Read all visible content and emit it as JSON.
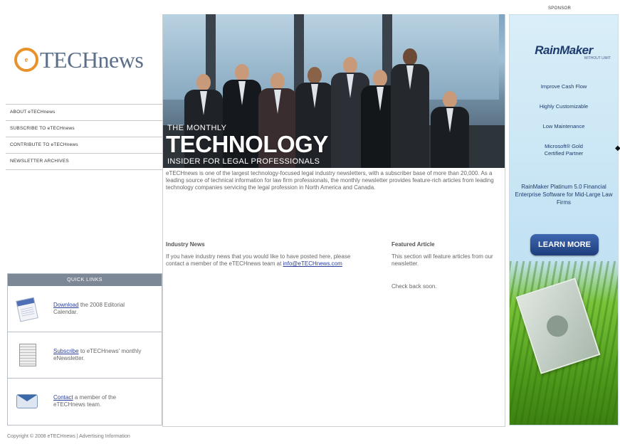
{
  "logo": {
    "mark": "e",
    "text": "TECHnews"
  },
  "nav": [
    {
      "label": "ABOUT eTECHnews"
    },
    {
      "label": "SUBSCRIBE TO eTECHnews"
    },
    {
      "label": "CONTRIBUTE TO eTECHnews"
    },
    {
      "label": "NEWSLETTER ARCHIVES"
    }
  ],
  "hero": {
    "kicker": "THE MONTHLY",
    "title": "TECHNOLOGY",
    "subtitle": "INSIDER FOR LEGAL PROFESSIONALS"
  },
  "intro": "eTECHnews is one of the largest technology-focused legal industry newsletters, with a subscriber base of more than 20,000. As a leading source of technical information for law firm professionals, the monthly newsletter provides feature-rich articles from leading technology companies servicing the legal profession in North America and Canada.",
  "industry_news": {
    "title": "Industry News",
    "text": "If you have industry news that you would like to have posted here, please contact a member of the eTECHnews team at",
    "link": "info@eTECHnews.com"
  },
  "featured": {
    "title": "Featured Article",
    "text": "This section will feature articles from our newsletter.",
    "text2": "Check back soon."
  },
  "quick_links": {
    "title": "QUICK LINKS",
    "items": [
      {
        "link": "Download",
        "text": "the 2008 Editorial Calendar.",
        "icon": "calendar-icon"
      },
      {
        "link": "Subscribe",
        "text": "to eTECHnews' monthly eNewsletter.",
        "icon": "newsletter-icon"
      },
      {
        "link": "Contact",
        "text": "a member of the eTECHnews team.",
        "icon": "mail-icon"
      }
    ]
  },
  "sponsor": {
    "label": "SPONSOR",
    "brand": "RainMaker",
    "brand_sub": "WITHOUT LIMIT",
    "lines": [
      "Improve Cash Flow",
      "Highly Customizable",
      "Low Maintenance",
      "Microsoft® Gold",
      "Certified Partner"
    ],
    "description": "RainMaker Platinum 5.0 Financial Enterprise Software for Mid-Large Law Firms",
    "button": "LEARN MORE"
  },
  "footer": "Copyright © 2008 eTECHnews  |  Advertising Information"
}
